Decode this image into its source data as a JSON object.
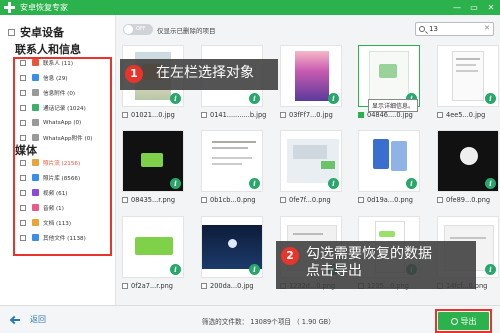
{
  "window": {
    "title": "安卓恢复专家",
    "controls": [
      "—",
      "▭",
      "✕"
    ]
  },
  "sidebar": {
    "device_label": "安卓设备",
    "contacts_section": "联系人和信息",
    "media_section": "媒体",
    "contacts_items": [
      {
        "label": "联系人 (11)",
        "icon": "contacts-icon",
        "color": "#e8553a"
      },
      {
        "label": "信息 (29)",
        "icon": "message-icon",
        "color": "#3a8de8"
      },
      {
        "label": "信息附件 (0)",
        "icon": "attachment-icon",
        "color": "#999999"
      },
      {
        "label": "通话记录 (1024)",
        "icon": "call-log-icon",
        "color": "#3ab06a"
      },
      {
        "label": "WhatsApp (0)",
        "icon": "whatsapp-icon",
        "color": "#999999"
      },
      {
        "label": "WhatsApp附件 (0)",
        "icon": "whatsapp-attachment-icon",
        "color": "#999999"
      }
    ],
    "media_items": [
      {
        "label": "照片流 (2156)",
        "icon": "photo-stream-icon",
        "color": "#e8a53a",
        "highlight": true
      },
      {
        "label": "照片库 (8566)",
        "icon": "photo-library-icon",
        "color": "#3a8de8"
      },
      {
        "label": "视频 (61)",
        "icon": "video-icon",
        "color": "#8a4ad8"
      },
      {
        "label": "音频 (1)",
        "icon": "audio-icon",
        "color": "#e85a8a"
      },
      {
        "label": "文档 (113)",
        "icon": "document-icon",
        "color": "#e8a53a"
      },
      {
        "label": "其他文件 (1138)",
        "icon": "other-files-icon",
        "color": "#3a8de8"
      }
    ]
  },
  "toolbar": {
    "toggle_state": "OFF",
    "only_deleted_label": "仅显示已删除的项目",
    "search_value": "13",
    "search_clear": "✕"
  },
  "files": [
    {
      "name": "01021...0.jpg",
      "art": "poster"
    },
    {
      "name": "0141...........b.jpg",
      "art": "blank"
    },
    {
      "name": "03fFf7...0.jpg",
      "art": "purple-photo"
    },
    {
      "name": "04846....0.jpg",
      "art": "screenshot-green",
      "checked": true
    },
    {
      "name": "4ee5...0.jpg",
      "art": "phone-doc"
    },
    {
      "name": "08435...r.png",
      "art": "green-chip"
    },
    {
      "name": "0b1cb...0.png",
      "art": "doc-lines"
    },
    {
      "name": "0fe7f...0.png",
      "art": "doc-screen"
    },
    {
      "name": "0d19a...0.png",
      "art": "phone-pair"
    },
    {
      "name": "0fe89...0.png",
      "art": "dark-splash"
    },
    {
      "name": "0f2a7...r.png",
      "art": "green-chip-2"
    },
    {
      "name": "200da...0.jpg",
      "art": "night-moon"
    },
    {
      "name": "1232d...0.png",
      "art": "doc-gray"
    },
    {
      "name": "1235...0.png",
      "art": "chat"
    },
    {
      "name": "14fcf...0.png",
      "art": "doc-gray-2"
    }
  ],
  "info_glyph": "i",
  "callouts": [
    {
      "number": "1",
      "text": "在左栏选择对象"
    },
    {
      "number": "2",
      "text": "勾选需要恢复的数据\n点击导出"
    }
  ],
  "tooltip": "显示详细信息。",
  "bottom": {
    "back_label": "返回",
    "status": "筛选的文件数： 13089个项目 （ 1.90 GB）",
    "export_label": "导出"
  }
}
